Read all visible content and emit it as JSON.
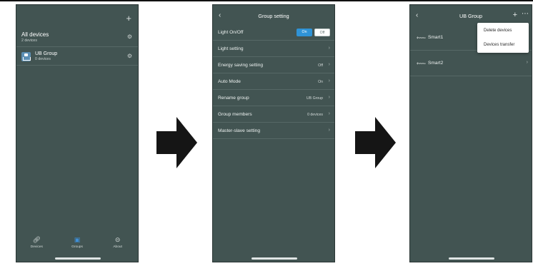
{
  "colors": {
    "screen_bg": "#425452",
    "accent": "#2f93d6",
    "tab_active": "#3e8ed6",
    "arrow": "#151515"
  },
  "screen1": {
    "header_icon": "plus-icon",
    "all_devices": {
      "title": "All devices",
      "subtitle": "2 devices"
    },
    "group": {
      "title": "UB Group",
      "subtitle": "0 devices"
    },
    "tabs": [
      {
        "label": "Devices",
        "icon": "link-icon"
      },
      {
        "label": "Groups",
        "icon": "groups-icon",
        "active": true
      },
      {
        "label": "About",
        "icon": "info-icon"
      }
    ]
  },
  "screen2": {
    "title": "Group setting",
    "rows": [
      {
        "label": "Light On/Off",
        "on": "On",
        "off": "Off"
      },
      {
        "label": "Light setting",
        "value": ""
      },
      {
        "label": "Energy saving setting",
        "value": "Off"
      },
      {
        "label": "Auto Mode",
        "value": "On"
      },
      {
        "label": "Rename group",
        "value": "UB Group"
      },
      {
        "label": "Group members",
        "value": "0 devices"
      },
      {
        "label": "Master-slave setting",
        "value": ""
      }
    ]
  },
  "screen3": {
    "title": "UB Group",
    "devices": [
      "Smart1",
      "Smart2"
    ],
    "menu": [
      "Delete devices",
      "Devices transfer"
    ]
  }
}
